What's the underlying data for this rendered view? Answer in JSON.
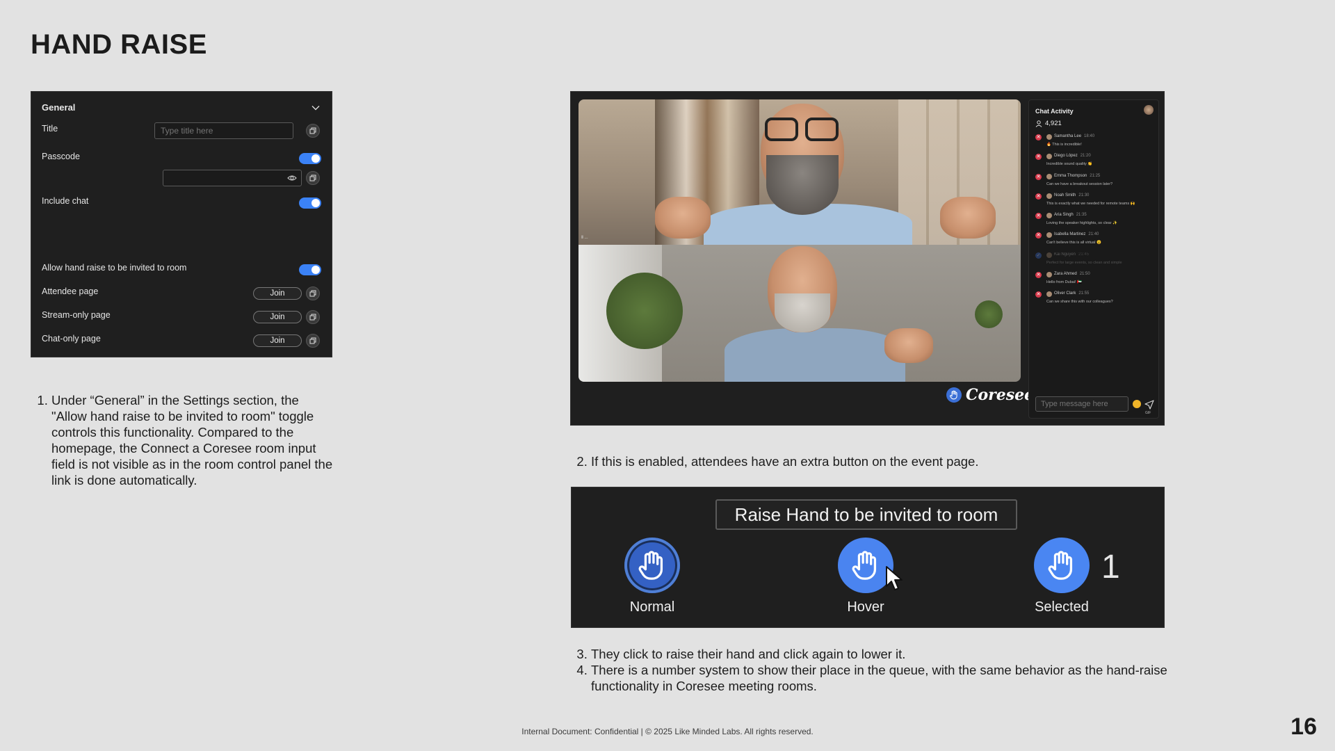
{
  "page": {
    "title": "HAND RAISE",
    "page_number": "16",
    "footer": "Internal Document: Confidential  |  © 2025 Like Minded Labs. All rights reserved."
  },
  "settings": {
    "section_title": "General",
    "title_label": "Title",
    "title_placeholder": "Type title here",
    "passcode_label": "Passcode",
    "include_chat_label": "Include chat",
    "allow_hand_raise_label": "Allow hand raise to be invited to room",
    "attendee_label": "Attendee page",
    "stream_only_label": "Stream-only page",
    "chat_only_label": "Chat-only page",
    "join_label": "Join",
    "toggles": {
      "passcode": true,
      "include_chat": true,
      "allow_hand_raise": true
    }
  },
  "notes": {
    "note1": "Under “General” in the Settings section, the \"Allow hand raise to be invited to room\" toggle controls this functionality. Compared to the homepage, the Connect a Coresee room input field is not visible as in the room control panel the link is done automatically.",
    "note2": "If this is enabled, attendees have an extra button on the event page.",
    "note3": "They click to raise their hand and click again to lower it.",
    "note4": "There is a number system to show their place in the queue, with the same behavior as the hand-raise functionality in Coresee meeting rooms."
  },
  "video": {
    "brand": "Coresee",
    "chat": {
      "title": "Chat Activity",
      "count": "4,921",
      "input_placeholder": "Type message here",
      "gif_label": "GIF",
      "messages": [
        {
          "name": "Samantha Lee",
          "time": "18:40",
          "text": "🔥 This is incredible!",
          "faded": false
        },
        {
          "name": "Diego López",
          "time": "21:20",
          "text": "Incredible sound quality 👏",
          "faded": false
        },
        {
          "name": "Emma Thompson",
          "time": "21:25",
          "text": "Can we have a breakout session later?",
          "faded": false
        },
        {
          "name": "Noah Smith",
          "time": "21:30",
          "text": "This is exactly what we needed for remote teams 🙌",
          "faded": false
        },
        {
          "name": "Aria Singh",
          "time": "21:35",
          "text": "Loving the speaker highlights, so clear ✨",
          "faded": false
        },
        {
          "name": "Isabella Martinez",
          "time": "21:40",
          "text": "Can't believe this is all virtual 😮",
          "faded": false
        },
        {
          "name": "Kai Nguyen",
          "time": "21:45",
          "text": "Perfect for large events, so clean and simple",
          "faded": true
        },
        {
          "name": "Zara Ahmed",
          "time": "21:50",
          "text": "Hello from Dubai! 🇦🇪",
          "faded": false
        },
        {
          "name": "Oliver Clark",
          "time": "21:55",
          "text": "Can we share this with our colleagues?",
          "faded": false
        }
      ]
    }
  },
  "hand_raise": {
    "button_label": "Raise Hand to be invited to room",
    "states": {
      "normal": "Normal",
      "hover": "Hover",
      "selected": "Selected"
    },
    "queue_number": "1"
  },
  "colors": {
    "accent": "#3b74e0",
    "panel": "#1f1f1f",
    "background": "#e2e2e2",
    "error": "#d93a4c"
  }
}
